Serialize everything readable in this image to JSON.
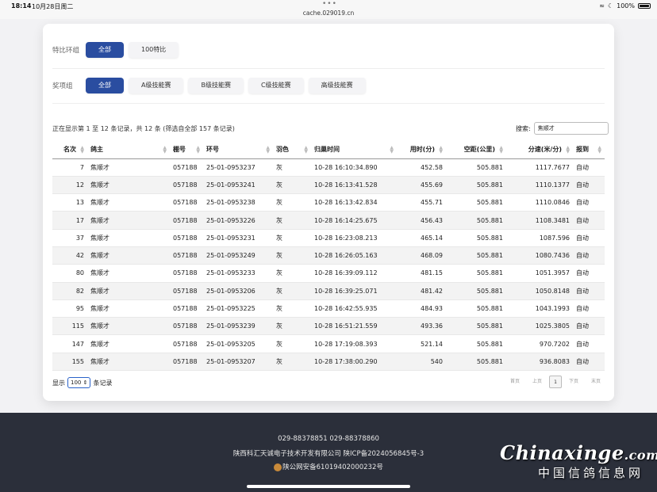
{
  "status_bar": {
    "time": "18:14",
    "date": "10月28日周二",
    "url": "cache.029019.cn",
    "battery": "100%"
  },
  "filters": {
    "ring_label": "特比环组",
    "ring_options": [
      "全部",
      "100特比"
    ],
    "award_label": "奖项组",
    "award_options": [
      "全部",
      "A级技能赛",
      "B级技能赛",
      "C级技能赛",
      "高级技能赛"
    ]
  },
  "info_text": "正在显示第 1 至 12 条记录，共 12 条 (筛选自全部 157 条记录)",
  "search": {
    "label": "搜索:",
    "value": "焦顺才"
  },
  "table": {
    "headers": [
      "名次",
      "鸽主",
      "棚号",
      "环号",
      "羽色",
      "归巢时间",
      "用时(分)",
      "空距(公里)",
      "分速(米/分)",
      "报到"
    ],
    "rows": [
      [
        "7",
        "焦顺才",
        "057188",
        "25-01-0953237",
        "灰",
        "10-28 16:10:34.890",
        "452.58",
        "505.881",
        "1117.7677",
        "自动"
      ],
      [
        "12",
        "焦顺才",
        "057188",
        "25-01-0953241",
        "灰",
        "10-28 16:13:41.528",
        "455.69",
        "505.881",
        "1110.1377",
        "自动"
      ],
      [
        "13",
        "焦顺才",
        "057188",
        "25-01-0953238",
        "灰",
        "10-28 16:13:42.834",
        "455.71",
        "505.881",
        "1110.0846",
        "自动"
      ],
      [
        "17",
        "焦顺才",
        "057188",
        "25-01-0953226",
        "灰",
        "10-28 16:14:25.675",
        "456.43",
        "505.881",
        "1108.3481",
        "自动"
      ],
      [
        "37",
        "焦顺才",
        "057188",
        "25-01-0953231",
        "灰",
        "10-28 16:23:08.213",
        "465.14",
        "505.881",
        "1087.596",
        "自动"
      ],
      [
        "42",
        "焦顺才",
        "057188",
        "25-01-0953249",
        "灰",
        "10-28 16:26:05.163",
        "468.09",
        "505.881",
        "1080.7436",
        "自动"
      ],
      [
        "80",
        "焦顺才",
        "057188",
        "25-01-0953233",
        "灰",
        "10-28 16:39:09.112",
        "481.15",
        "505.881",
        "1051.3957",
        "自动"
      ],
      [
        "82",
        "焦顺才",
        "057188",
        "25-01-0953206",
        "灰",
        "10-28 16:39:25.071",
        "481.42",
        "505.881",
        "1050.8148",
        "自动"
      ],
      [
        "95",
        "焦顺才",
        "057188",
        "25-01-0953225",
        "灰",
        "10-28 16:42:55.935",
        "484.93",
        "505.881",
        "1043.1993",
        "自动"
      ],
      [
        "115",
        "焦顺才",
        "057188",
        "25-01-0953239",
        "灰",
        "10-28 16:51:21.559",
        "493.36",
        "505.881",
        "1025.3805",
        "自动"
      ],
      [
        "147",
        "焦顺才",
        "057188",
        "25-01-0953205",
        "灰",
        "10-28 17:19:08.393",
        "521.14",
        "505.881",
        "970.7202",
        "自动"
      ],
      [
        "155",
        "焦顺才",
        "057188",
        "25-01-0953207",
        "灰",
        "10-28 17:38:00.290",
        "540",
        "505.881",
        "936.8083",
        "自动"
      ]
    ]
  },
  "page_size": {
    "prefix": "显示",
    "value": "100",
    "suffix": "条记录"
  },
  "pager": {
    "first": "首页",
    "prev": "上页",
    "current": "1",
    "next": "下页",
    "last": "末页"
  },
  "footer": {
    "phones": "029-88378851    029-88378860",
    "company": "陕西科汇天诚电子技术开发有限公司 陕ICP备2024056845号-3",
    "police": "陕公网安备61019402000232号"
  },
  "watermark": {
    "main": "Chinaxinge",
    "suffix": ".com",
    "sub": "中国信鸽信息网"
  },
  "colors": {
    "accent": "#2a4da0",
    "footer_bg": "#2b2f3a"
  }
}
